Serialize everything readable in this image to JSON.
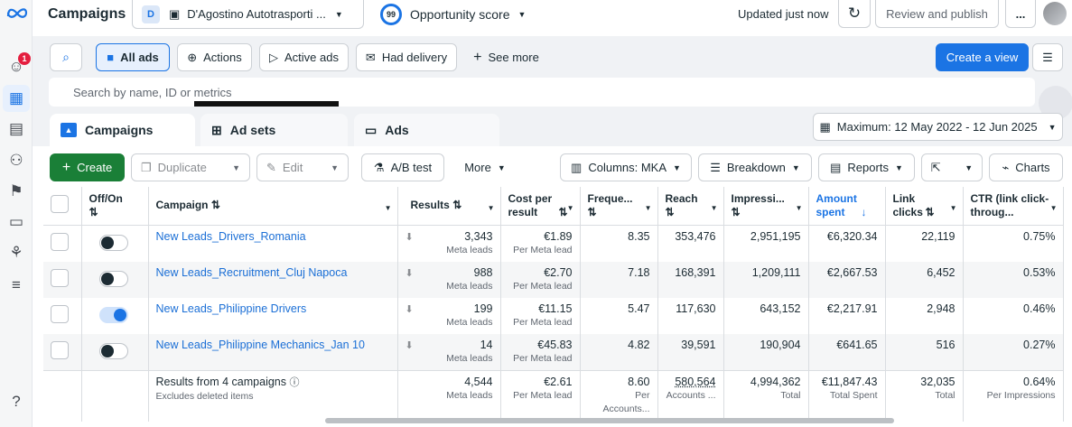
{
  "app": {
    "title": "Campaigns",
    "notifications": "1"
  },
  "account": {
    "initial": "D",
    "name": "D'Agostino Autotrasporti ..."
  },
  "opportunity": {
    "score": "99",
    "label": "Opportunity score"
  },
  "status": {
    "updated": "Updated just now"
  },
  "actions": {
    "review": "Review and publish",
    "more": "..."
  },
  "toolbar": {
    "all_ads": "All ads",
    "actions": "Actions",
    "active_ads": "Active ads",
    "had_delivery": "Had delivery",
    "see_more": "See more",
    "create_view": "Create a view"
  },
  "search": {
    "placeholder": "Search by name, ID or metrics"
  },
  "tabs": {
    "campaigns": "Campaigns",
    "ad_sets": "Ad sets",
    "ads": "Ads"
  },
  "date_range": "Maximum: 12 May 2022 - 12 Jun 2025",
  "tabletoolbar": {
    "create": "Create",
    "duplicate": "Duplicate",
    "edit": "Edit",
    "ab_test": "A/B test",
    "more": "More",
    "columns": "Columns: MKA",
    "breakdown": "Breakdown",
    "reports": "Reports",
    "charts": "Charts"
  },
  "columns": {
    "offon": "Off/On",
    "campaign": "Campaign",
    "results": "Results",
    "cost": "Cost per result",
    "freq": "Freque...",
    "reach": "Reach",
    "impr": "Impressi...",
    "amount": "Amount spent",
    "clicks": "Link clicks",
    "ctr": "CTR (link click-throug..."
  },
  "rows": [
    {
      "name": "New Leads_Drivers_Romania",
      "on": false,
      "results": "3,343",
      "results_sub": "Meta leads",
      "cost": "€1.89",
      "cost_sub": "Per Meta lead",
      "freq": "8.35",
      "reach": "353,476",
      "impr": "2,951,195",
      "amount": "€6,320.34",
      "clicks": "22,119",
      "ctr": "0.75%"
    },
    {
      "name": "New Leads_Recruitment_Cluj Napoca",
      "on": false,
      "results": "988",
      "results_sub": "Meta leads",
      "cost": "€2.70",
      "cost_sub": "Per Meta lead",
      "freq": "7.18",
      "reach": "168,391",
      "impr": "1,209,111",
      "amount": "€2,667.53",
      "clicks": "6,452",
      "ctr": "0.53%"
    },
    {
      "name": "New Leads_Philippine Drivers",
      "on": true,
      "results": "199",
      "results_sub": "Meta leads",
      "cost": "€11.15",
      "cost_sub": "Per Meta lead",
      "freq": "5.47",
      "reach": "117,630",
      "impr": "643,152",
      "amount": "€2,217.91",
      "clicks": "2,948",
      "ctr": "0.46%"
    },
    {
      "name": "New Leads_Philippine Mechanics_Jan 10",
      "on": false,
      "results": "14",
      "results_sub": "Meta leads",
      "cost": "€45.83",
      "cost_sub": "Per Meta lead",
      "freq": "4.82",
      "reach": "39,591",
      "impr": "190,904",
      "amount": "€641.65",
      "clicks": "516",
      "ctr": "0.27%"
    }
  ],
  "summary": {
    "label": "Results from 4 campaigns",
    "sub": "Excludes deleted items",
    "results": "4,544",
    "results_sub": "Meta leads",
    "cost": "€2.61",
    "cost_sub": "Per Meta lead",
    "freq": "8.60",
    "freq_sub": "Per Accounts...",
    "reach": "580,564",
    "reach_sub": "Accounts ...",
    "impr": "4,994,362",
    "impr_sub": "Total",
    "amount": "€11,847.43",
    "amount_sub": "Total Spent",
    "clicks": "32,035",
    "clicks_sub": "Total",
    "ctr": "0.64%",
    "ctr_sub": "Per Impressions"
  },
  "colors": {
    "accent": "#1b74e4",
    "green": "#1a7f37"
  }
}
